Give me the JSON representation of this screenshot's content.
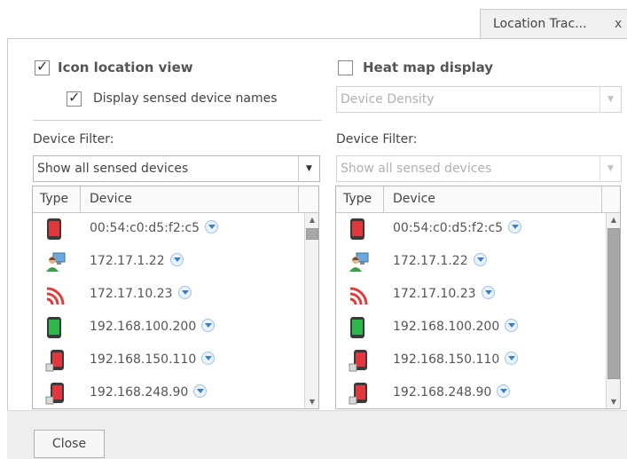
{
  "tab": {
    "title": "Location Trac...",
    "close": "x"
  },
  "left_panel": {
    "icon_location_view": {
      "label": "Icon location view",
      "checked": true
    },
    "display_names": {
      "label": "Display sensed device names",
      "checked": true
    },
    "device_filter_label": "Device Filter:",
    "device_filter_value": "Show all sensed devices",
    "columns": {
      "type": "Type",
      "device": "Device"
    },
    "rows": [
      {
        "icon": "mobile-phone-red-icon",
        "device": "00:54:c0:d5:f2:c5"
      },
      {
        "icon": "computer-user-icon",
        "device": "172.17.1.22"
      },
      {
        "icon": "wireless-signal-icon",
        "device": "172.17.10.23"
      },
      {
        "icon": "mobile-phone-green-icon",
        "device": "192.168.100.200"
      },
      {
        "icon": "mobile-phone-warning-icon",
        "device": "192.168.150.110"
      },
      {
        "icon": "mobile-phone-warning-icon",
        "device": "192.168.248.90"
      }
    ]
  },
  "right_panel": {
    "heat_map_display": {
      "label": "Heat map display",
      "checked": false
    },
    "density_value": "Device Density",
    "device_filter_label": "Device Filter:",
    "device_filter_value": "Show all sensed devices",
    "columns": {
      "type": "Type",
      "device": "Device"
    },
    "rows": [
      {
        "icon": "mobile-phone-red-icon",
        "device": "00:54:c0:d5:f2:c5"
      },
      {
        "icon": "computer-user-icon",
        "device": "172.17.1.22"
      },
      {
        "icon": "wireless-signal-icon",
        "device": "172.17.10.23"
      },
      {
        "icon": "mobile-phone-green-icon",
        "device": "192.168.100.200"
      },
      {
        "icon": "mobile-phone-warning-icon",
        "device": "192.168.150.110"
      },
      {
        "icon": "mobile-phone-warning-icon",
        "device": "192.168.248.90"
      }
    ]
  },
  "footer": {
    "close_label": "Close"
  },
  "colors": {
    "phone_red": "#e0383d",
    "phone_green": "#2fb84a",
    "wireless": "#e23b3b",
    "expander": "#3b7fc4"
  }
}
